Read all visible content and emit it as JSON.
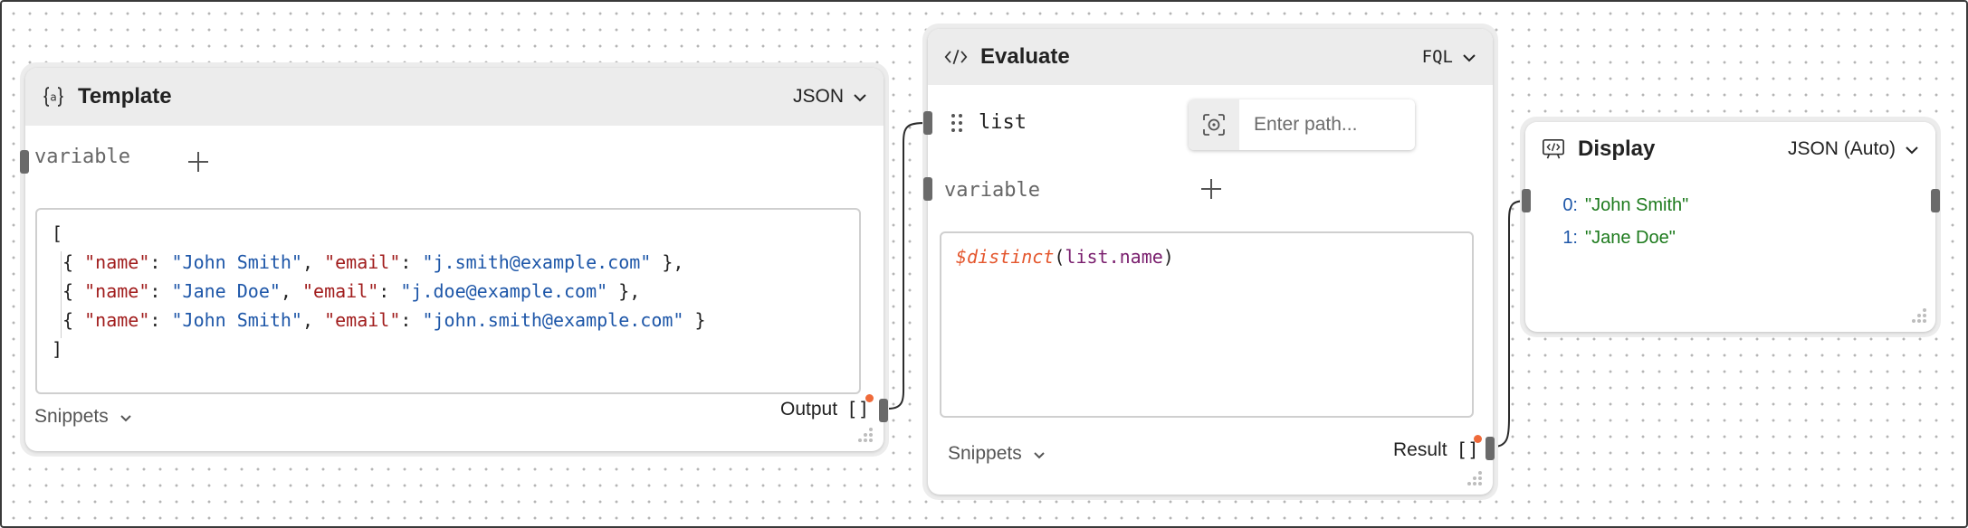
{
  "colors": {
    "wire": "#2b2b2b",
    "port_active": "#ef6a3a",
    "key": "#a11d1d",
    "string": "#1d56a8",
    "function": "#e4572e",
    "display_value": "#1c7a1c"
  },
  "template_node": {
    "title": "Template",
    "icon": "braces-a-icon",
    "mode": "JSON",
    "variable_label": "variable",
    "code_lines": [
      {
        "open": "[",
        "close": ""
      },
      {
        "k1": "\"name\"",
        "v1": "\"John Smith\"",
        "k2": "\"email\"",
        "v2": "\"j.smith@example.com\"",
        "end": " },"
      },
      {
        "k1": "\"name\"",
        "v1": "\"Jane Doe\"",
        "k2": "\"email\"",
        "v2": "\"j.doe@example.com\"",
        "end": " },"
      },
      {
        "k1": "\"name\"",
        "v1": "\"John Smith\"",
        "k2": "\"email\"",
        "v2": "\"john.smith@example.com\"",
        "end": " }"
      }
    ],
    "snippets_label": "Snippets",
    "output_label": "Output",
    "output_bracket": "[]"
  },
  "evaluate_node": {
    "title": "Evaluate",
    "icon": "code-icon",
    "mode": "FQL",
    "list_label": "list",
    "path_placeholder": "Enter path...",
    "variable_label": "variable",
    "expression": {
      "fn": "$distinct",
      "open": "(",
      "arg": "list.name",
      "close": ")"
    },
    "snippets_label": "Snippets",
    "result_label": "Result",
    "result_bracket": "[]"
  },
  "display_node": {
    "title": "Display",
    "icon": "display-code-icon",
    "mode": "JSON (Auto)",
    "items": [
      {
        "index": "0:",
        "value": "\"John Smith\""
      },
      {
        "index": "1:",
        "value": "\"Jane Doe\""
      }
    ]
  }
}
